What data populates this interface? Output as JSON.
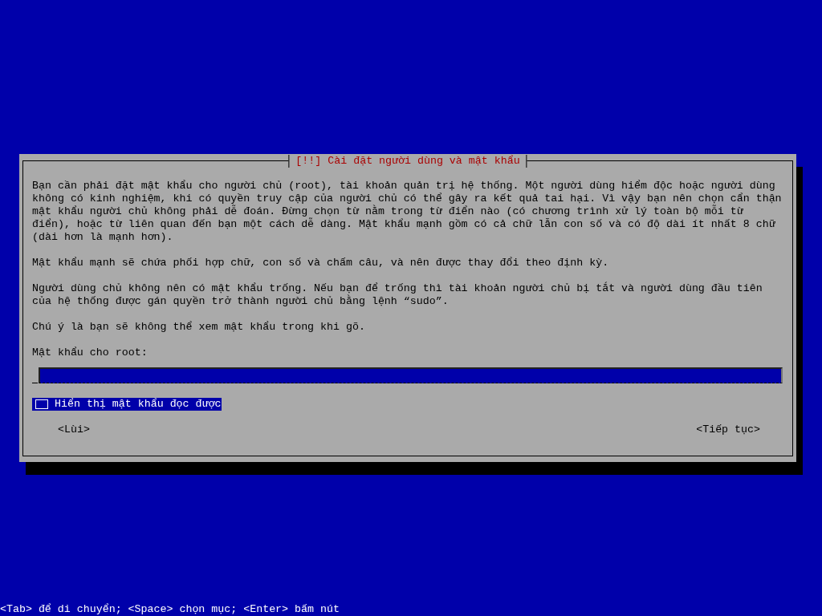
{
  "dialog": {
    "title": "[!!] Cài đặt người dùng và mật khẩu",
    "paragraphs": [
      {
        "lines": [
          "Bạn cần phải đặt mật khẩu cho người chủ (root), tài khoản quản trị hệ thống. Một người dùng hiểm độc hoặc người dùng",
          "không có kinh nghiệm, khi có quyền truy cập của người chủ có thể gây ra kết quả tai hại. Vì vậy bạn nên chọn cẩn thận",
          "mật khẩu người chủ không phải dễ đoán. Đừng chọn từ nằm trong từ điển nào (có chương trình xử lý toàn bộ mỗi từ",
          "điển), hoặc từ liên quan đến bạn một cách dễ dàng. Mật khẩu mạnh gồm có cả chữ lẫn con số và có độ dài ít nhất 8 chữ",
          "(dài hơn là mạnh hơn)."
        ]
      },
      {
        "lines": [
          "Mật khẩu mạnh sẽ chứa phối hợp chữ, con số và chấm câu, và nên được thay đổi theo định kỳ."
        ]
      },
      {
        "lines": [
          "Người dùng chủ không nên có mật khẩu trống. Nếu bạn để trống thì tài khoản người chủ bị tắt và người dùng đầu tiên",
          "của hệ thống được gán quyền trở thành người chủ bằng lệnh “sudo”."
        ]
      },
      {
        "lines": [
          "Chú ý là bạn sẽ không thể xem mật khẩu trong khi gõ."
        ]
      }
    ],
    "field_label": "Mật khẩu cho root:",
    "show_password": {
      "label": "Hiển thị mật khẩu đọc được",
      "checked": false,
      "focused": true
    },
    "buttons": [
      {
        "label": "<Lùi>"
      },
      {
        "label": "<Tiếp tục>"
      }
    ]
  },
  "status_bar": "<Tab> để di chuyển; <Space> chọn mục; <Enter> bấm nút"
}
